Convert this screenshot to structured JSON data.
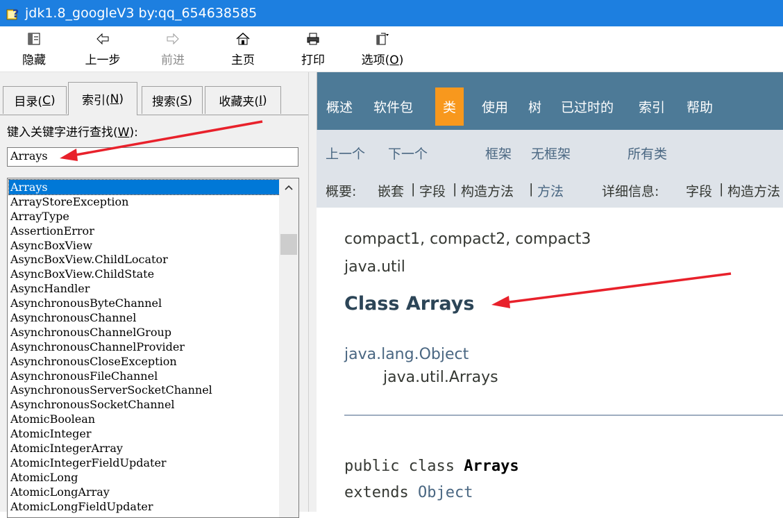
{
  "window": {
    "title": "jdk1.8_googleV3 by:qq_654638585"
  },
  "toolbar": {
    "hide": "隐藏",
    "back": "上一步",
    "forward": "前进",
    "home": "主页",
    "print": "打印",
    "options_prefix": "选项(",
    "options_key": "O",
    "options_suffix": ")"
  },
  "tabs": [
    {
      "label": "目录(",
      "key": "C",
      "suffix": ")"
    },
    {
      "label": "索引(",
      "key": "N",
      "suffix": ")"
    },
    {
      "label": "搜索(",
      "key": "S",
      "suffix": ")"
    },
    {
      "label": "收藏夹(",
      "key": "I",
      "suffix": ")"
    }
  ],
  "index": {
    "label_prefix": "键入关键字进行查找(",
    "label_key": "W",
    "label_suffix": "):",
    "keyword": "Arrays",
    "items": [
      "Arrays",
      "ArrayStoreException",
      "ArrayType",
      "AssertionError",
      "AsyncBoxView",
      "AsyncBoxView.ChildLocator",
      "AsyncBoxView.ChildState",
      "AsyncHandler",
      "AsynchronousByteChannel",
      "AsynchronousChannel",
      "AsynchronousChannelGroup",
      "AsynchronousChannelProvider",
      "AsynchronousCloseException",
      "AsynchronousFileChannel",
      "AsynchronousServerSocketChannel",
      "AsynchronousSocketChannel",
      "AtomicBoolean",
      "AtomicInteger",
      "AtomicIntegerArray",
      "AtomicIntegerFieldUpdater",
      "AtomicLong",
      "AtomicLongArray",
      "AtomicLongFieldUpdater"
    ]
  },
  "javadoc": {
    "nav": {
      "overview": "概述",
      "package": "软件包",
      "class": "类",
      "use": "使用",
      "tree": "树",
      "deprecated": "已过时的",
      "index": "索引",
      "help": "帮助"
    },
    "subnav": {
      "prev": "上一个",
      "next": "下一个",
      "frames": "框架",
      "noframes": "无框架",
      "allclasses": "所有类",
      "summary_label": "概要:",
      "nested": "嵌套",
      "sep": "|",
      "field": "字段",
      "constr": "构造方法",
      "method": "方法",
      "detail_label": "详细信息:",
      "detail_field": "字段",
      "detail_constr": "构造方法"
    },
    "profiles": "compact1, compact2, compact3",
    "package": "java.util",
    "class_title": "Class Arrays",
    "inherit_parent": "java.lang.Object",
    "inherit_child": "java.util.Arrays",
    "decl_public": "public class ",
    "decl_name": "Arrays",
    "decl_extends": "extends ",
    "decl_object": "Object"
  },
  "colors": {
    "titlebar": "#1d7fe0",
    "nav_bg": "#4d7a97",
    "nav_active": "#f8981d",
    "subnav_bg": "#dee3e9",
    "selection": "#0078d7",
    "annotation": "#e8212b"
  }
}
